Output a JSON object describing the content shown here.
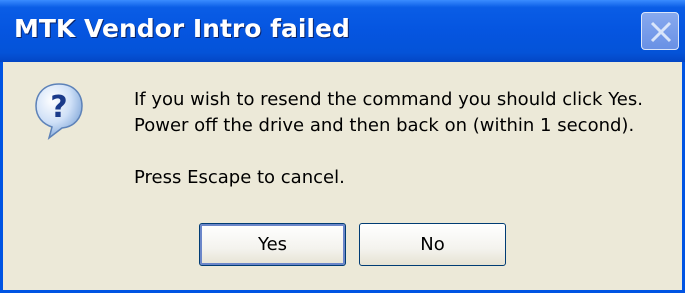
{
  "dialog": {
    "title": "MTK Vendor Intro failed",
    "icon": "question-icon",
    "message_lines": [
      "If you wish to resend the command you should click Yes.",
      "Power off the drive and then back on (within 1 second).",
      "",
      "Press Escape to cancel."
    ],
    "buttons": {
      "yes_label": "Yes",
      "no_label": "No"
    },
    "colors": {
      "titlebar": "#0555e0",
      "body": "#ece9d8",
      "button_border": "#003c74"
    }
  }
}
